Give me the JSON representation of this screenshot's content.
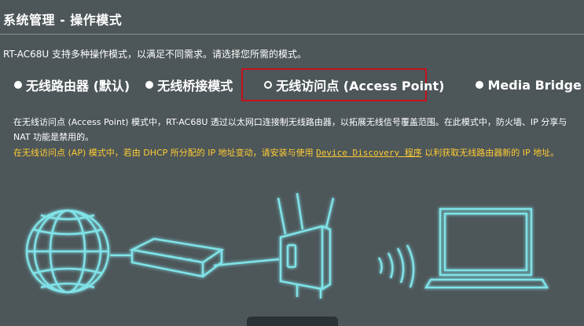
{
  "page": {
    "title": "系统管理 - 操作模式",
    "description": "RT-AC68U 支持多种操作模式，以满足不同需求。请选择您所需的模式。"
  },
  "modes": [
    {
      "label": "无线路由器 (默认)",
      "selected": false
    },
    {
      "label": "无线桥接模式",
      "selected": false
    },
    {
      "label": "无线访问点 (Access Point)",
      "selected": true
    },
    {
      "label": "Media Bridge",
      "selected": false
    }
  ],
  "info": {
    "line1": "在无线访问点 (Access Point) 模式中，RT-AC68U 透过以太网口连接制无线路由器，以拓展无线信号覆盖范围。在此模式中，防火墙、IP 分享与 NAT 功能是禁用的。",
    "line2_before": "在无线访问点 (AP) 模式中，若由 DHCP 所分配的 IP 地址变动，请安装与使用 ",
    "line2_link": "Device Discovery 程序",
    "line2_after": " 以利获取无线路由器新的 IP 地址。"
  },
  "colors": {
    "background": "#4d5659",
    "selection_border": "#c5121b",
    "warning_text": "#ffcc33",
    "illustration_glow": "#7fe3e8"
  },
  "icons": [
    "globe-icon",
    "modem-icon",
    "router-icon",
    "wifi-waves-icon",
    "laptop-icon"
  ]
}
